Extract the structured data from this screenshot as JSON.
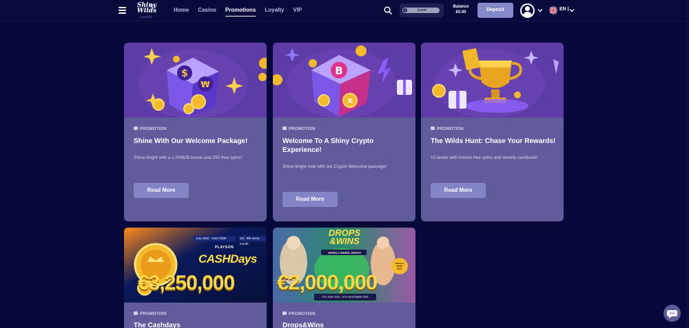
{
  "brand": {
    "logo_text": "Shiny Wilds",
    "logo_sub": "CASINO"
  },
  "nav": {
    "items": [
      "Home",
      "Casino",
      "Promotions",
      "Loyalty",
      "VIP"
    ],
    "active": "Promotions"
  },
  "level": {
    "number": "1",
    "label": "Level"
  },
  "balance": {
    "label": "Balance",
    "value": "€0.00"
  },
  "deposit_label": "Deposit",
  "language": "EN |",
  "cards": [
    {
      "tag": "PROMOTION",
      "title": "Shine With Our Welcome Package!",
      "description": "Shine bright with a 1,000€/$ bonus and 250 free spins!",
      "button": "Read More"
    },
    {
      "tag": "PROMOTION",
      "title": "Welcome To A Shiny Crypto Experience!",
      "description": "Shine bright now with our Crypto Welcome package!",
      "button": "Read More"
    },
    {
      "tag": "PROMOTION",
      "title": "The Wilds Hunt: Chase Your Rewards!",
      "description": "12 levels with instant free spins and weekly cashback!",
      "button": "Read More"
    },
    {
      "tag": "PROMOTION",
      "title": "The Cashdays",
      "banner": {
        "dates": "July 2025 - June 2026",
        "period": "1st - 8th every month",
        "provider": "PLAYSON",
        "headline": "CASHDays",
        "amount": "€3,250,000"
      }
    },
    {
      "tag": "PROMOTION",
      "title": "Drops&Wins",
      "banner": {
        "headline": "DROPS &WINS",
        "subline": "WEEKLY WHEEL DROPS",
        "side_badge": "WEEKLY PRIZE POOL",
        "amount": "€2,000,000",
        "dates": "6TH JUNE 2025 - 10TH NOVEMBER 2025"
      }
    }
  ],
  "colors": {
    "background": "#07093a",
    "card": "#605c9c",
    "card_art": "#5e3ca6",
    "button": "#8384c6",
    "deposit": "#8489c8"
  }
}
